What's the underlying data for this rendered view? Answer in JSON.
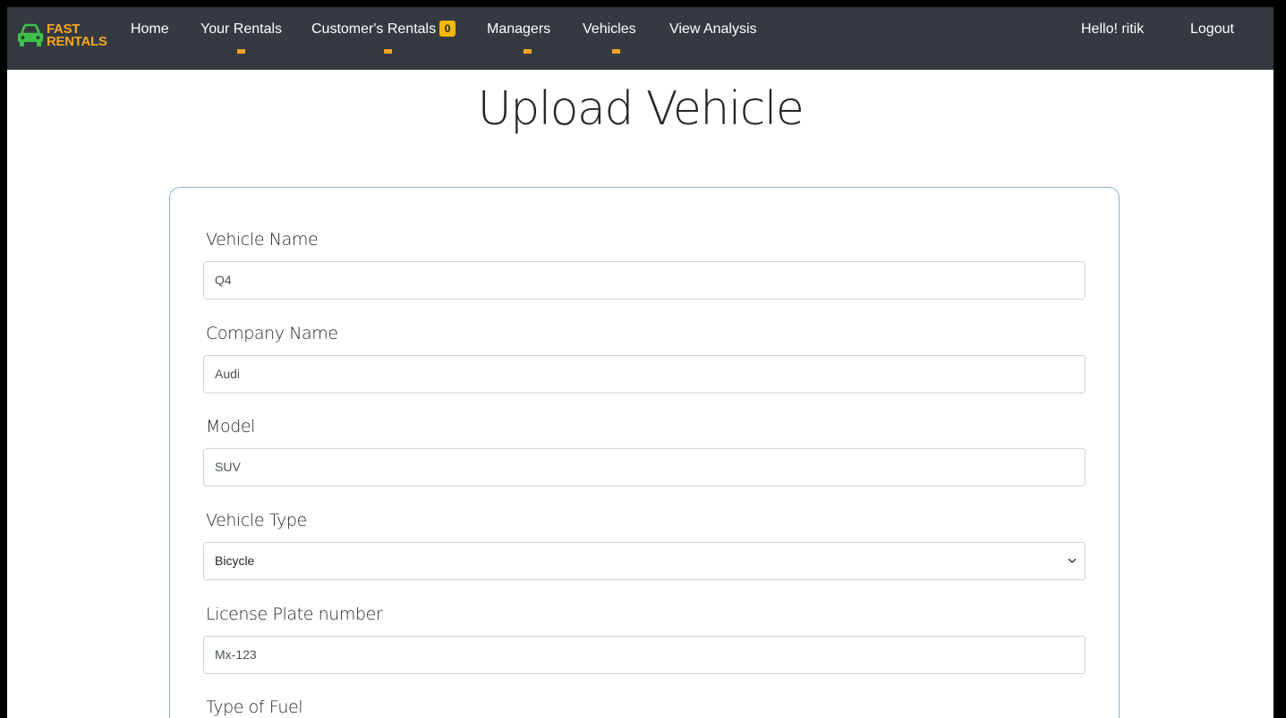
{
  "brand": {
    "line1": "FAST",
    "line2": "RENTALS",
    "icon": "car-icon",
    "color": "#f5a623"
  },
  "nav": {
    "home": "Home",
    "your_rentals": "Your Rentals",
    "customers_rentals": "Customer's Rentals",
    "customers_rentals_badge": "0",
    "managers": "Managers",
    "vehicles": "Vehicles",
    "view_analysis": "View Analysis",
    "greeting": "Hello! ritik",
    "logout": "Logout",
    "bg_color": "#343a40",
    "accent_color": "#f5a623"
  },
  "page": {
    "title": "Upload Vehicle"
  },
  "form": {
    "vehicle_name": {
      "label": "Vehicle Name",
      "value": "Q4"
    },
    "company_name": {
      "label": "Company Name",
      "value": "Audi"
    },
    "model": {
      "label": "Model",
      "value": "SUV"
    },
    "vehicle_type": {
      "label": "Vehicle Type",
      "selected": "Bicycle"
    },
    "license_plate": {
      "label": "License Plate number",
      "value": "Mx-123"
    },
    "fuel_type": {
      "label": "Type of Fuel"
    }
  }
}
